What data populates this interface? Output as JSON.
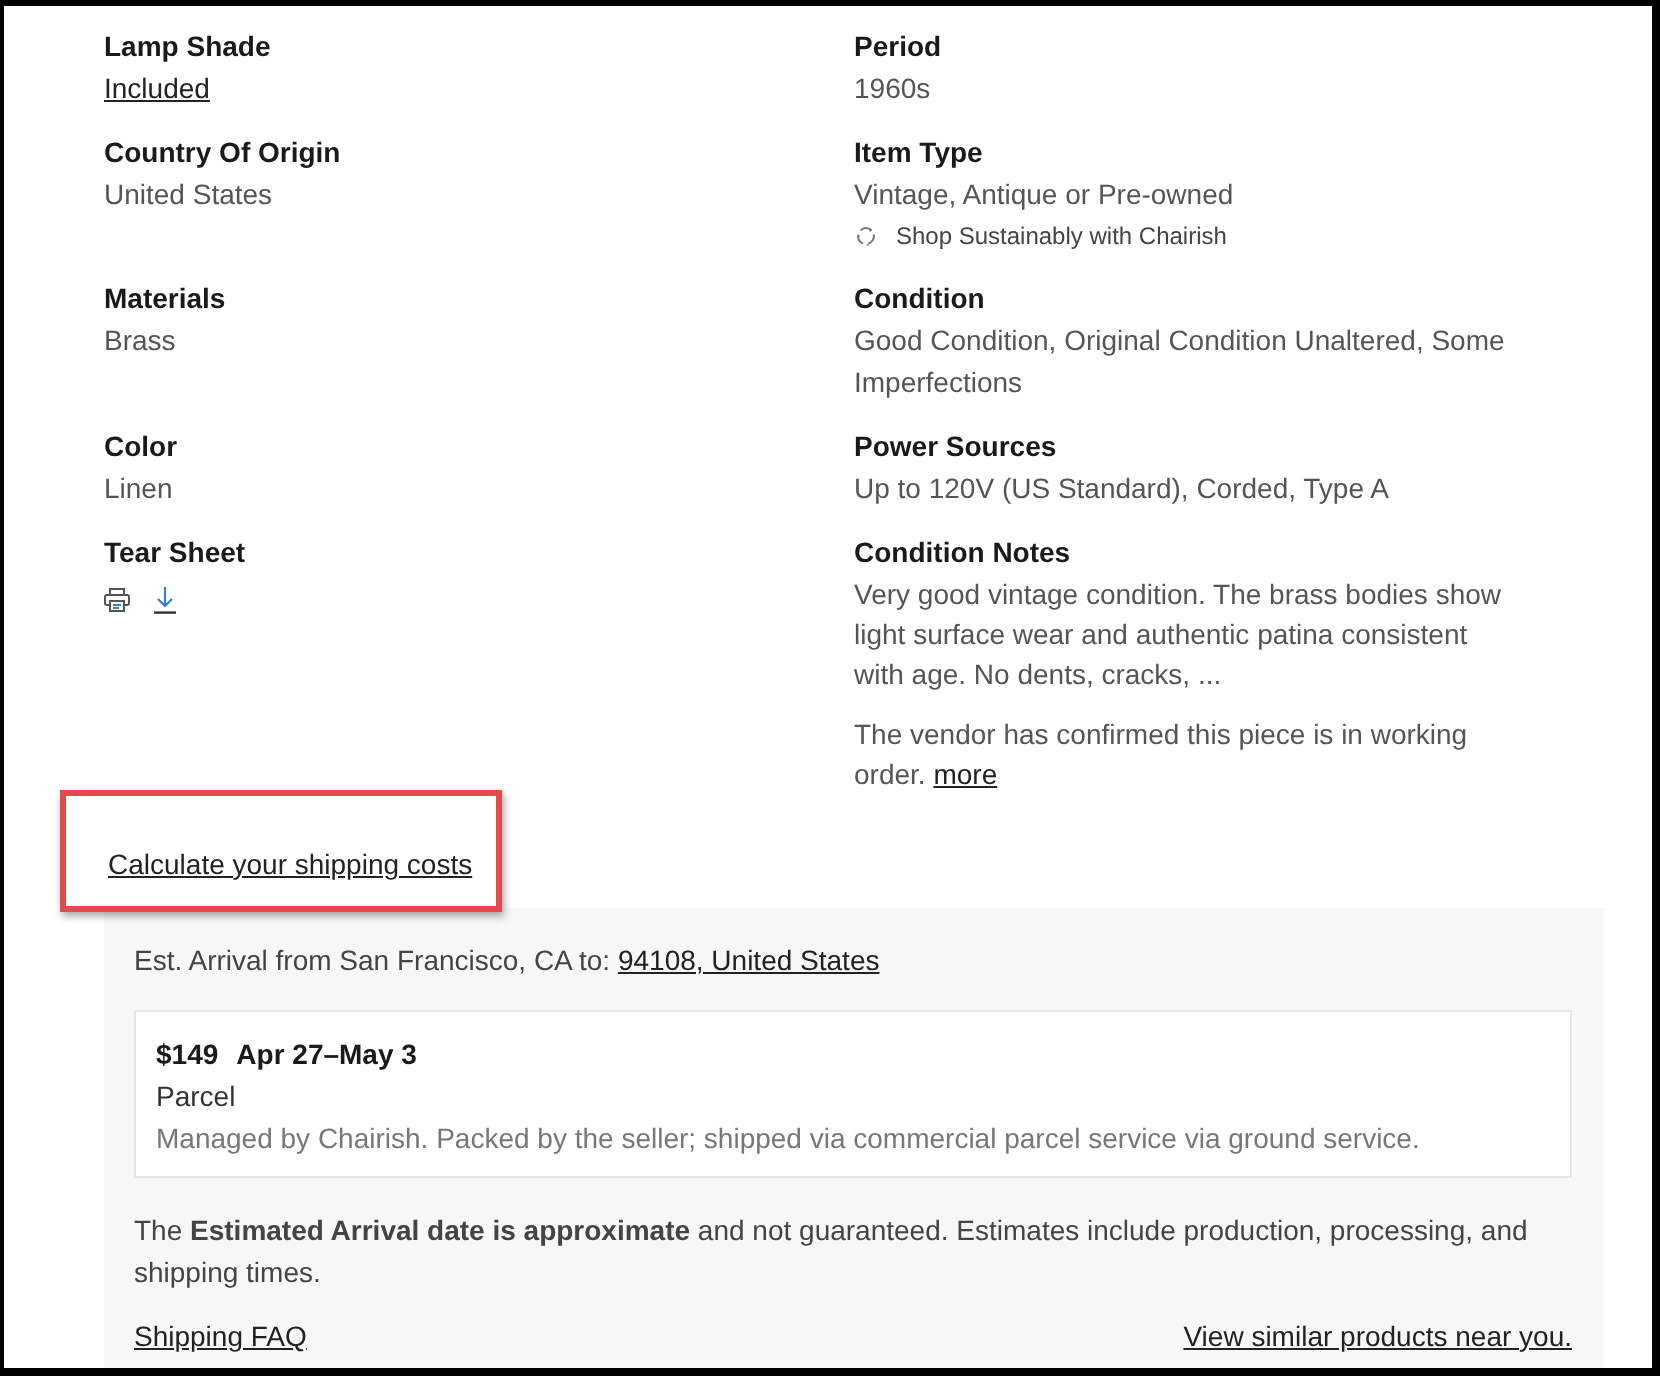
{
  "spec_rows": [
    [
      {
        "kind": "link",
        "label": "Lamp Shade",
        "value": "Included"
      },
      {
        "kind": "text",
        "label": "Period",
        "value": "1960s"
      }
    ],
    [
      {
        "kind": "text",
        "label": "Country Of Origin",
        "value": "United States"
      },
      {
        "kind": "text",
        "label": "Item Type",
        "value": "Vintage, Antique or Pre-owned",
        "note": "Shop Sustainably with Chairish"
      }
    ],
    [
      {
        "kind": "text",
        "label": "Materials",
        "value": "Brass"
      },
      {
        "kind": "text",
        "label": "Condition",
        "value": "Good Condition, Original Condition Unaltered, Some Imperfections"
      }
    ],
    [
      {
        "kind": "text",
        "label": "Color",
        "value": "Linen"
      },
      {
        "kind": "text",
        "label": "Power Sources",
        "value": "Up to 120V (US Standard), Corded, Type A"
      }
    ],
    [
      {
        "kind": "icons",
        "label": "Tear Sheet"
      },
      {
        "kind": "notes",
        "label": "Condition Notes",
        "paragraphs": [
          "Very good vintage condition. The brass bodies show light surface wear and authentic patina consistent with age. No dents, cracks, ...",
          "The vendor has confirmed this piece is in working order."
        ],
        "more_link": "more"
      }
    ]
  ],
  "shipping": {
    "calculate_link": "Calculate your shipping costs",
    "highlighted": true,
    "arrival_label": "Est. Arrival from San Francisco, CA to:",
    "destination_link": "94108, United States",
    "options": [
      {
        "price": "$149",
        "dates": "Apr 27–May 3",
        "method": "Parcel",
        "description": "Managed by Chairish. Packed by the seller; shipped via commercial parcel service via ground service."
      }
    ],
    "disclaimer": "The **Estimated Arrival date is approximate** and not guaranteed. Estimates include production, processing, and shipping times.",
    "faq_link": "Shipping FAQ",
    "similar_link": "View similar products near you."
  }
}
